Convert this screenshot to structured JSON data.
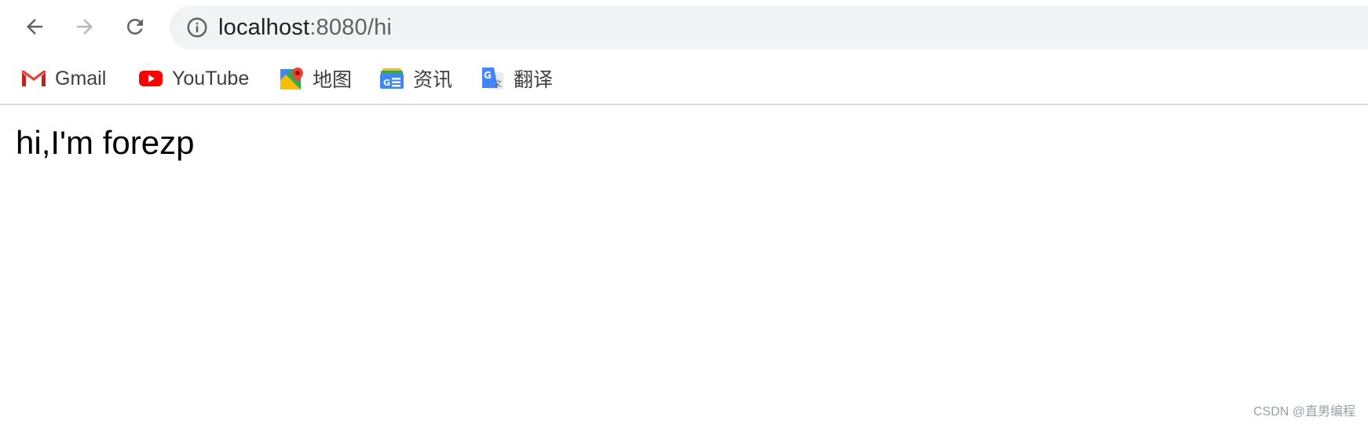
{
  "toolbar": {
    "back_icon": "arrow-left-icon",
    "forward_icon": "arrow-right-icon",
    "reload_icon": "reload-icon",
    "address": {
      "info_icon": "info-circle-icon",
      "host": "localhost",
      "path": ":8080/hi"
    }
  },
  "bookmarks": [
    {
      "label": "Gmail",
      "icon": "gmail-icon"
    },
    {
      "label": "YouTube",
      "icon": "youtube-icon"
    },
    {
      "label": "地图",
      "icon": "maps-icon"
    },
    {
      "label": "资讯",
      "icon": "news-icon"
    },
    {
      "label": "翻译",
      "icon": "translate-icon"
    }
  ],
  "page": {
    "text": "hi,I'm forezp"
  },
  "watermark": "CSDN @直男编程",
  "colors": {
    "omnibox_bg": "#f1f3f4",
    "icon_gray": "#5f6368",
    "forward_disabled": "#b7b9bc",
    "youtube_red": "#ff0000",
    "gmail_red": "#ea4335"
  }
}
